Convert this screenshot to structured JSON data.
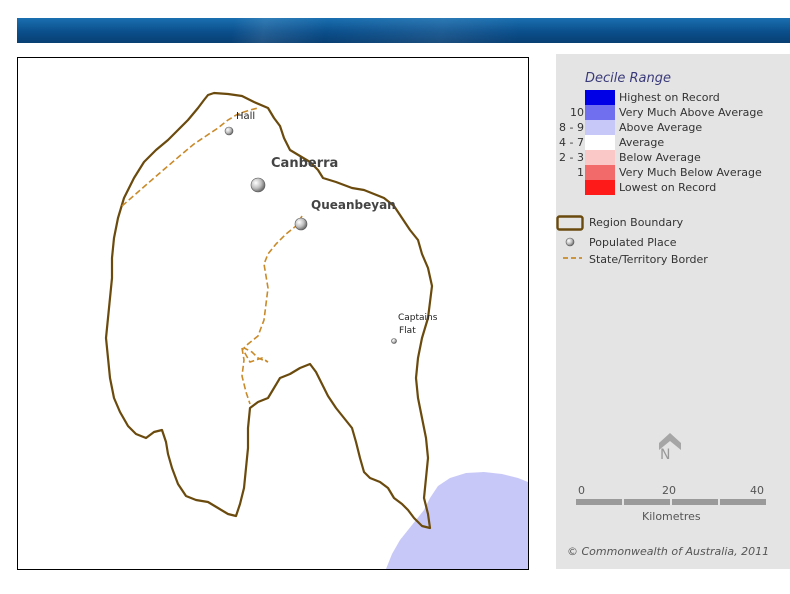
{
  "legend": {
    "title": "Decile Range",
    "deciles": [
      {
        "num": "",
        "label": "Highest on Record",
        "color": "#0000e6"
      },
      {
        "num": "10",
        "label": "Very Much Above Average",
        "color": "#6f6ff0"
      },
      {
        "num": "8 - 9",
        "label": "Above Average",
        "color": "#c8c8f8"
      },
      {
        "num": "4 - 7",
        "label": "Average",
        "color": "#ffffff"
      },
      {
        "num": "2 - 3",
        "label": "Below Average",
        "color": "#fbc8c8"
      },
      {
        "num": "1",
        "label": "Very Much Below Average",
        "color": "#f26a6a"
      },
      {
        "num": "",
        "label": "Lowest on Record",
        "color": "#ff1a1a"
      }
    ],
    "symbols": {
      "region_boundary": "Region Boundary",
      "populated_place": "Populated Place",
      "state_border": "State/Territory Border"
    }
  },
  "map": {
    "places": {
      "hall": "Hall",
      "canberra": "Canberra",
      "queanbeyan": "Queanbeyan",
      "captains_flat_1": "Captains",
      "captains_flat_2": "Flat"
    },
    "colors": {
      "boundary": "#6b4a0e",
      "border": "#c98a2a",
      "above_average_fill": "#c8c8f8"
    }
  },
  "north_arrow": {
    "label": "N"
  },
  "scale": {
    "ticks": [
      "0",
      "20",
      "40"
    ],
    "unit": "Kilometres"
  },
  "copyright": "© Commonwealth of Australia, 2011"
}
